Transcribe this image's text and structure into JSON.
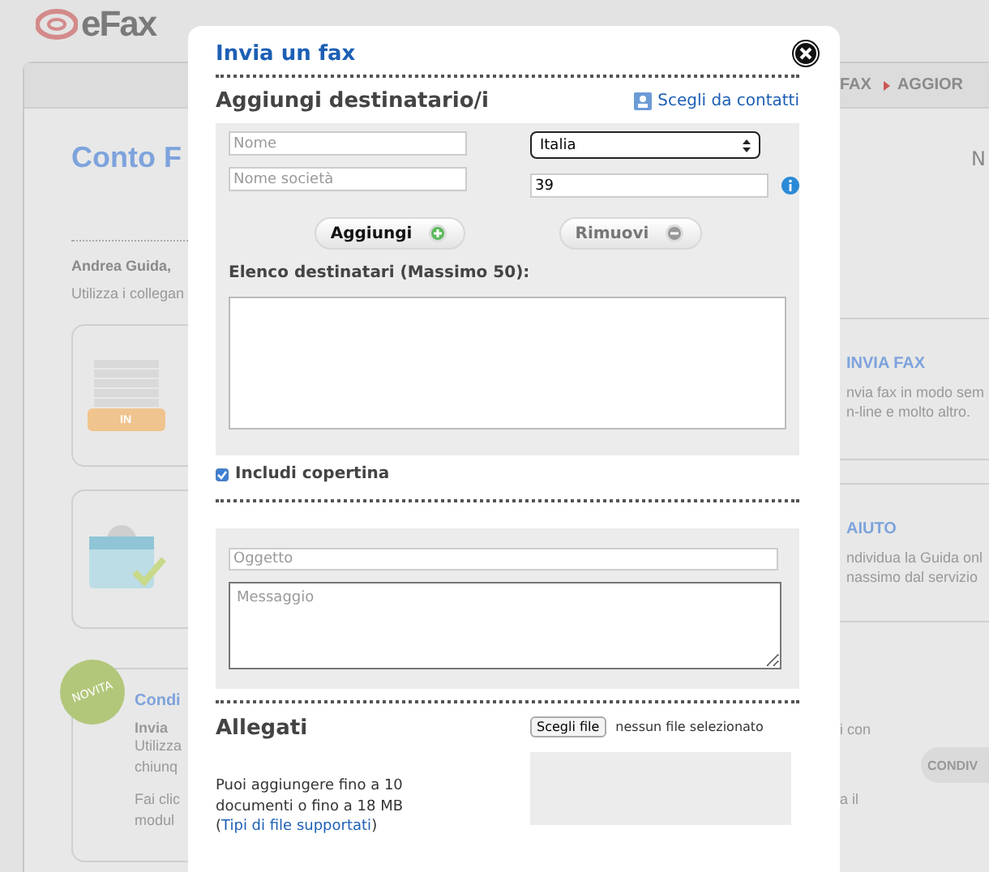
{
  "background_page": {
    "logo": "eFax",
    "nav": [
      {
        "label": "FAX",
        "arrow": false
      },
      {
        "label": "AGGIOR",
        "arrow": true
      }
    ],
    "title": "Conto F",
    "title_right": "N",
    "greeting": "Andrea Guida,",
    "intro": "Utilizza i collegan",
    "cards": [
      {
        "kind": "tray",
        "icon_label": "IN",
        "heading": "INVIA FAX",
        "lines": [
          "nvia fax in modo sem",
          "n-line e molto altro."
        ]
      },
      {
        "kind": "calendar",
        "heading": "AIUTO",
        "lines": [
          "ndividua la Guida onl",
          "nassimo dal servizio"
        ]
      }
    ],
    "promo": {
      "badge": "NOVITA",
      "heading": "Condi",
      "subheading": "Invia",
      "lines_left": [
        "Utilizza",
        "chiunq",
        "Fai clic",
        "modul"
      ],
      "lines_right": [
        "i con",
        "a il"
      ],
      "button": "CONDIV"
    }
  },
  "dialog": {
    "title": "Invia un fax",
    "recipients": {
      "heading": "Aggiungi destinatario/i",
      "contacts_link": "Scegli da contatti",
      "name": {
        "placeholder": "Nome"
      },
      "company": {
        "placeholder": "Nome società"
      },
      "country": {
        "value": "Italia"
      },
      "fax_number": {
        "value": "39"
      },
      "buttons": [
        {
          "kind": "add",
          "label": "Aggiungi",
          "disabled": false
        },
        {
          "kind": "remove",
          "label": "Rimuovi",
          "disabled": true
        }
      ],
      "list_label": "Elenco destinatari (Massimo 50):"
    },
    "cover": {
      "label": "Includi copertina",
      "checked": true
    },
    "subject": {
      "placeholder": "Oggetto"
    },
    "message": {
      "placeholder": "Messaggio"
    },
    "attachments": {
      "heading": "Allegati",
      "file_button": "Scegli file",
      "file_status": "nessun file selezionato",
      "note": "Puoi aggiungere fino a 10 documenti o fino a 18 MB (",
      "note_link": "Tipi di file supportati",
      "note_end": ")"
    }
  }
}
